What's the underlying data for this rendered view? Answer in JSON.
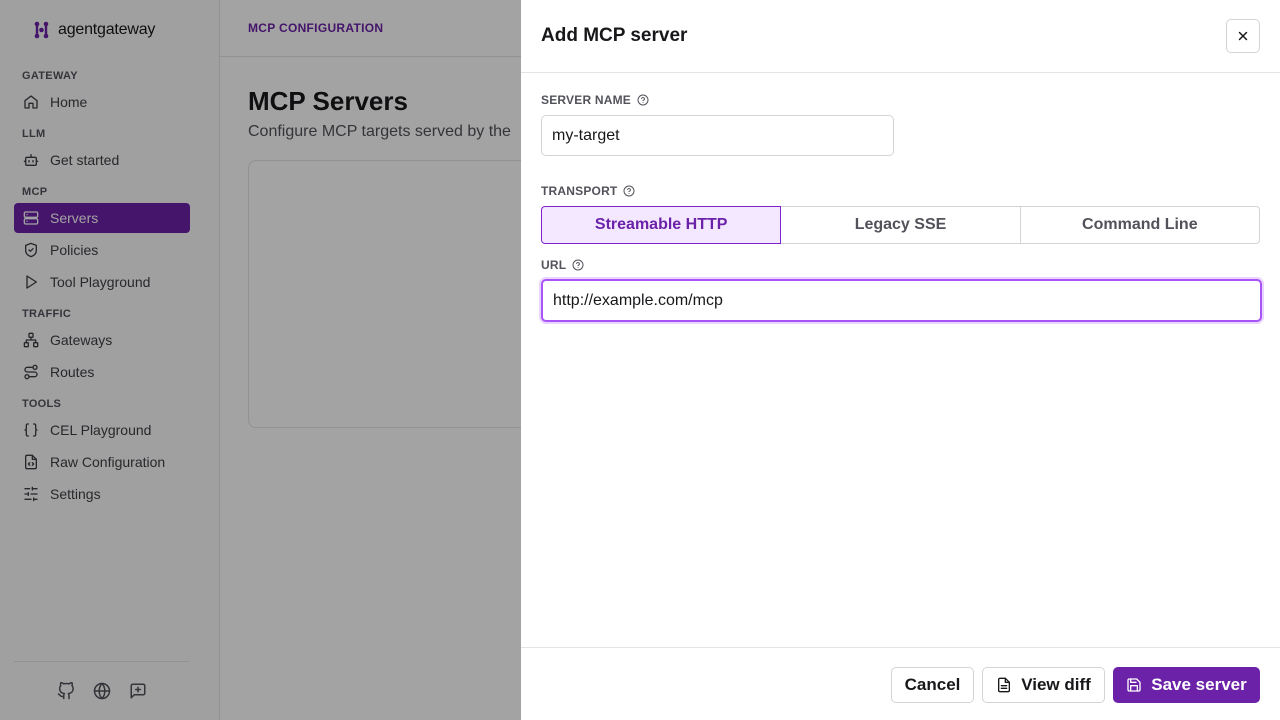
{
  "app": {
    "logo_text": "agentgateway"
  },
  "sidebar": {
    "sections": [
      {
        "label": "GATEWAY"
      },
      {
        "label": "LLM"
      },
      {
        "label": "MCP"
      },
      {
        "label": "TRAFFIC"
      },
      {
        "label": "TOOLS"
      }
    ],
    "items": [
      {
        "label": "Home",
        "icon": "home-icon"
      },
      {
        "label": "Get started",
        "icon": "bot-icon"
      },
      {
        "label": "Servers",
        "icon": "server-icon",
        "active": true
      },
      {
        "label": "Policies",
        "icon": "shield-icon"
      },
      {
        "label": "Tool Playground",
        "icon": "play-icon"
      },
      {
        "label": "Gateways",
        "icon": "network-icon"
      },
      {
        "label": "Routes",
        "icon": "route-icon"
      },
      {
        "label": "CEL Playground",
        "icon": "braces-icon"
      },
      {
        "label": "Raw Configuration",
        "icon": "file-code-icon"
      },
      {
        "label": "Settings",
        "icon": "sliders-icon"
      }
    ],
    "footer_icons": [
      "github-icon",
      "globe-icon",
      "feedback-icon"
    ]
  },
  "main": {
    "breadcrumb": "MCP CONFIGURATION",
    "title": "MCP Servers",
    "subtitle": "Configure MCP targets served by the"
  },
  "drawer": {
    "title": "Add MCP server",
    "server_name_label": "SERVER NAME",
    "server_name_value": "my-target",
    "transport_label": "TRANSPORT",
    "transport_options": [
      "Streamable HTTP",
      "Legacy SSE",
      "Command Line"
    ],
    "transport_selected": "Streamable HTTP",
    "url_label": "URL",
    "url_value": "http://example.com/mcp",
    "cancel_label": "Cancel",
    "view_diff_label": "View diff",
    "save_label": "Save server"
  },
  "colors": {
    "accent": "#6b21a8",
    "accent_light": "#f3e8ff",
    "focus_ring": "#a855f7"
  }
}
